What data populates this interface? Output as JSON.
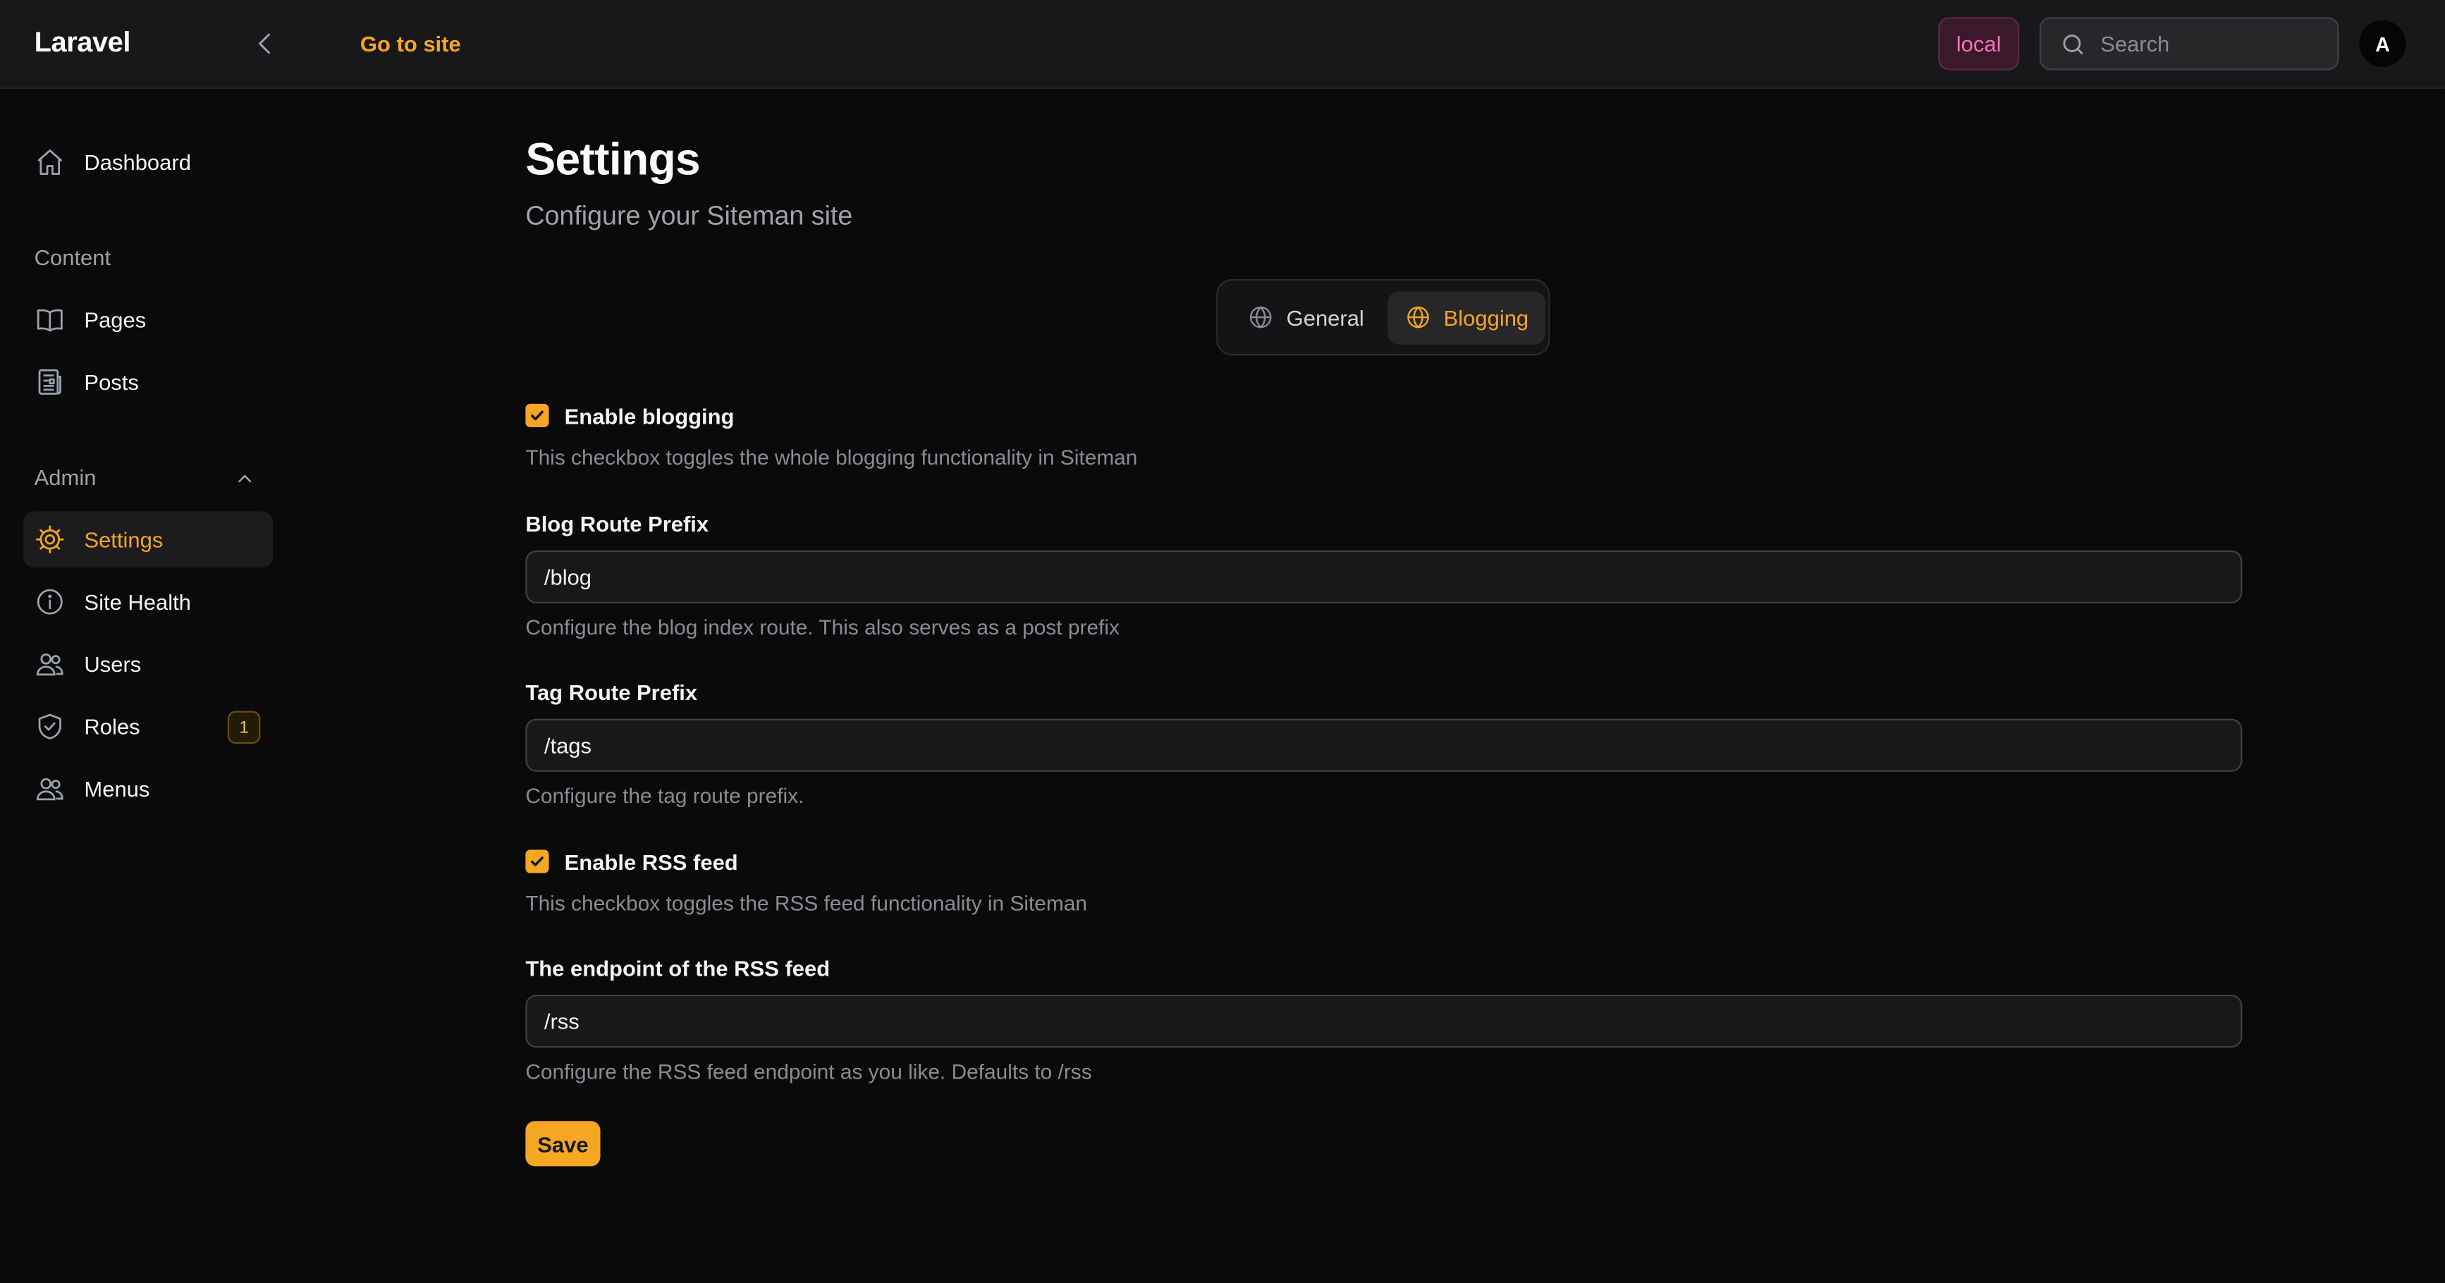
{
  "header": {
    "brand": "Laravel",
    "goto_label": "Go to site",
    "env_badge": "local",
    "search_placeholder": "Search",
    "avatar_initial": "A"
  },
  "sidebar": {
    "dashboard": "Dashboard",
    "content_group": "Content",
    "pages": "Pages",
    "posts": "Posts",
    "admin_group": "Admin",
    "settings": "Settings",
    "site_health": "Site Health",
    "users": "Users",
    "roles": "Roles",
    "roles_count": "1",
    "menus": "Menus",
    "active_item": "Settings"
  },
  "page": {
    "title": "Settings",
    "subtitle": "Configure your Siteman site"
  },
  "tabs": {
    "general": "General",
    "blogging": "Blogging",
    "active": "Blogging"
  },
  "form": {
    "enable_blogging": {
      "label": "Enable blogging",
      "checked": true,
      "help": "This checkbox toggles the whole blogging functionality in Siteman"
    },
    "blog_prefix": {
      "label": "Blog Route Prefix",
      "value": "/blog",
      "help": "Configure the blog index route. This also serves as a post prefix"
    },
    "tag_prefix": {
      "label": "Tag Route Prefix",
      "value": "/tags",
      "help": "Configure the tag route prefix."
    },
    "enable_rss": {
      "label": "Enable RSS feed",
      "checked": true,
      "help": "This checkbox toggles the RSS feed functionality in Siteman"
    },
    "rss_endpoint": {
      "label": "The endpoint of the RSS feed",
      "value": "/rss",
      "help": "Configure the RSS feed endpoint as you like. Defaults to /rss"
    },
    "save_label": "Save"
  },
  "colors": {
    "accent": "#f5a623",
    "background": "#0a0a0b",
    "topbar": "#18181b",
    "env_badge_text": "#f472b6"
  },
  "icons": {
    "collapse": "chevron-left-icon",
    "search": "search-icon",
    "dashboard": "home-icon",
    "pages": "book-open-icon",
    "posts": "newspaper-icon",
    "settings": "cog-icon",
    "site_health": "info-circle-icon",
    "users": "users-icon",
    "roles": "shield-check-icon",
    "menus": "users-icon",
    "tab": "globe-icon",
    "checkbox": "check-icon",
    "admin_toggle": "chevron-up-icon"
  }
}
